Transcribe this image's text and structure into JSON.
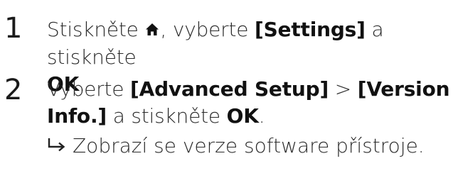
{
  "steps": [
    {
      "number": "1",
      "text_a": "Stiskněte ",
      "icon": "home-icon",
      "text_b": ", vyberte ",
      "kw1": "[Settings]",
      "text_c": " a stiskněte",
      "kw2": "OK",
      "text_d": "."
    },
    {
      "number": "2",
      "text_a": "Vyberte ",
      "kw1": "[Advanced Setup]",
      "text_b": " > ",
      "kw2": "[Version Info.]",
      "text_c": " a stiskněte ",
      "kw3": "OK",
      "text_d": ".",
      "result_icon": "result-arrow-icon",
      "result": "Zobrazí se verze software přístroje."
    }
  ]
}
